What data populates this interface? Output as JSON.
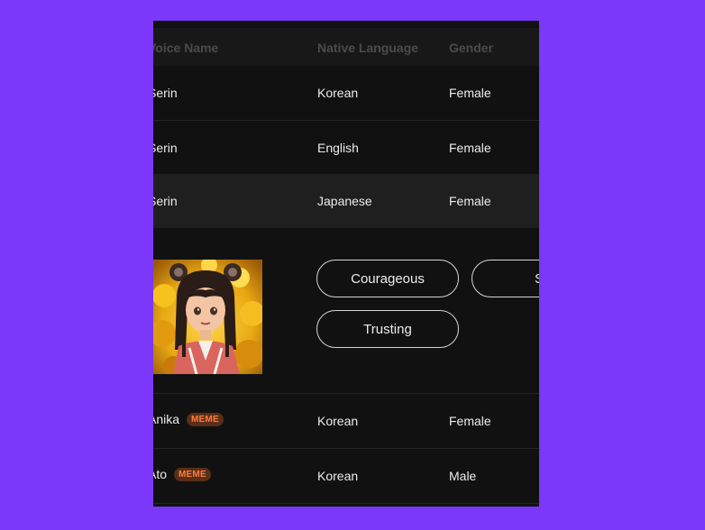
{
  "table": {
    "headers": {
      "voice_name": "Voice Name",
      "native_language": "Native Language",
      "gender": "Gender"
    },
    "rows": [
      {
        "name": "Serin",
        "language": "Korean",
        "gender": "Female"
      },
      {
        "name": "Serin",
        "language": "English",
        "gender": "Female"
      },
      {
        "name": "Serin",
        "language": "Japanese",
        "gender": "Female",
        "selected": true
      },
      {
        "name": "Anika",
        "badge": "MEME",
        "language": "Korean",
        "gender": "Female"
      },
      {
        "name": "Ato",
        "badge": "MEME",
        "language": "Korean",
        "gender": "Male"
      }
    ]
  },
  "detail": {
    "avatar_icon": "anime-girl-avatar",
    "traits": [
      "Courageous",
      "S",
      "Trusting"
    ]
  },
  "colors": {
    "page_background": "#7b38f9",
    "panel_background": "#111111",
    "badge_text": "#ff7e3a",
    "badge_background": "#5a2e18"
  }
}
